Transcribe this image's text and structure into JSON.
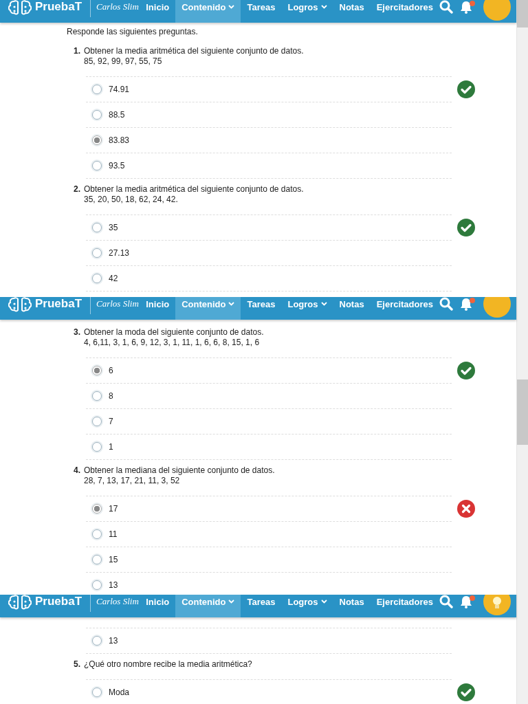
{
  "segments": [
    {
      "navbar": {
        "brand": "PruebaT",
        "partner": "Carlos Slim",
        "items": [
          {
            "label": "Inicio",
            "dropdown": false,
            "selected": false
          },
          {
            "label": "Contenido",
            "dropdown": true,
            "selected": true
          },
          {
            "label": "Tareas",
            "dropdown": false,
            "selected": false
          },
          {
            "label": "Logros",
            "dropdown": true,
            "selected": false
          },
          {
            "label": "Notas",
            "dropdown": false,
            "selected": false
          },
          {
            "label": "Ejercitadores",
            "dropdown": false,
            "selected": false
          }
        ],
        "notification": true,
        "avatar": {
          "kind": "plain"
        }
      },
      "blocks": [
        {
          "kind": "instructions",
          "text": "Responde las siguientes preguntas."
        },
        {
          "kind": "question",
          "number": "1.",
          "text": "Obtener la media aritmética del siguiente conjunto de datos.",
          "data": "85, 92, 99, 97, 55, 75",
          "correct": true,
          "options": [
            {
              "label": "74.91",
              "selected": false
            },
            {
              "label": "88.5",
              "selected": false
            },
            {
              "label": "83.83",
              "selected": true
            },
            {
              "label": "93.5",
              "selected": false
            }
          ]
        },
        {
          "kind": "question",
          "number": "2.",
          "text": "Obtener la media aritmética del siguiente conjunto de datos.",
          "data": "35, 20, 50, 18, 62, 24, 42.",
          "correct": true,
          "options": [
            {
              "label": "35",
              "selected": false
            },
            {
              "label": "27.13",
              "selected": false
            },
            {
              "label": "42",
              "selected": false
            }
          ]
        }
      ]
    },
    {
      "navbar": {
        "brand": "PruebaT",
        "partner": "Carlos Slim",
        "items": [
          {
            "label": "Inicio",
            "dropdown": false,
            "selected": false
          },
          {
            "label": "Contenido",
            "dropdown": true,
            "selected": true
          },
          {
            "label": "Tareas",
            "dropdown": false,
            "selected": false
          },
          {
            "label": "Logros",
            "dropdown": true,
            "selected": false
          },
          {
            "label": "Notas",
            "dropdown": false,
            "selected": false
          },
          {
            "label": "Ejercitadores",
            "dropdown": false,
            "selected": false
          }
        ],
        "notification": true,
        "avatar": {
          "kind": "plain"
        }
      },
      "blocks": [
        {
          "kind": "question",
          "number": "3.",
          "text": "Obtener la moda del siguiente conjunto de datos.",
          "data": "4, 6,11, 3, 1, 6, 9, 12, 3, 1, 11, 1, 6, 6, 8, 15, 1, 6",
          "correct": true,
          "options": [
            {
              "label": "6",
              "selected": true
            },
            {
              "label": "8",
              "selected": false
            },
            {
              "label": "7",
              "selected": false
            },
            {
              "label": "1",
              "selected": false
            }
          ]
        },
        {
          "kind": "question",
          "number": "4.",
          "text": "Obtener la mediana del siguiente conjunto de datos.",
          "data": "28, 7, 13, 17, 21, 11, 3, 52",
          "correct": false,
          "options": [
            {
              "label": "17",
              "selected": true
            },
            {
              "label": "11",
              "selected": false
            },
            {
              "label": "15",
              "selected": false
            },
            {
              "label": "13",
              "selected": false
            }
          ]
        }
      ]
    },
    {
      "navbar": {
        "brand": "PruebaT",
        "partner": "Carlos Slim",
        "items": [
          {
            "label": "Inicio",
            "dropdown": false,
            "selected": false
          },
          {
            "label": "Contenido",
            "dropdown": true,
            "selected": true
          },
          {
            "label": "Tareas",
            "dropdown": false,
            "selected": false
          },
          {
            "label": "Logros",
            "dropdown": true,
            "selected": false
          },
          {
            "label": "Notas",
            "dropdown": false,
            "selected": false
          },
          {
            "label": "Ejercitadores",
            "dropdown": false,
            "selected": false
          }
        ],
        "notification": true,
        "avatar": {
          "kind": "bulb"
        }
      },
      "blocks": [
        {
          "kind": "options",
          "options": [
            {
              "label": "13",
              "selected": false
            }
          ]
        },
        {
          "kind": "question",
          "number": "5.",
          "text": "¿Qué otro nombre recibe la media aritmética?",
          "correct": true,
          "options": [
            {
              "label": "Moda",
              "selected": false
            }
          ]
        }
      ]
    }
  ]
}
